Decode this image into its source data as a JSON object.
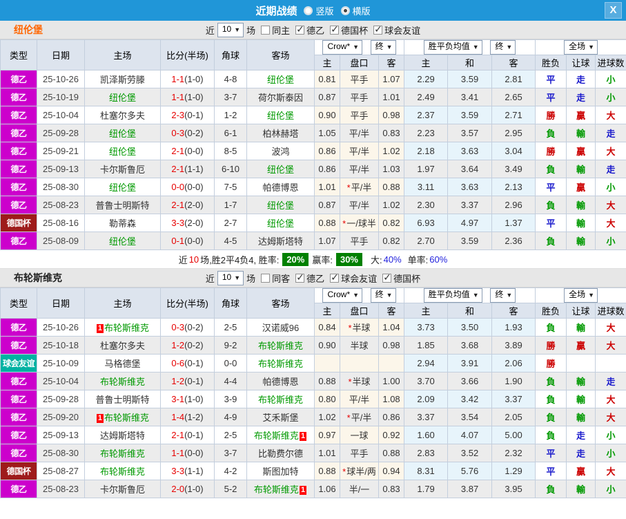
{
  "title_bar": {
    "title": "近期战绩",
    "radio_vertical": "竖版",
    "radio_horizontal": "横版",
    "close_label": "X"
  },
  "header": {
    "col_type": "类型",
    "col_date": "日期",
    "col_home": "主场",
    "col_score": "比分(半场)",
    "col_corner": "角球",
    "col_away": "客场",
    "select_bookmaker": "Crow*",
    "select_final1": "终",
    "select_avg": "胜平负均值",
    "select_final2": "终",
    "select_fullmatch": "全场",
    "sub": [
      "主",
      "盘口",
      "客",
      "主",
      "和",
      "客",
      "胜负",
      "让球",
      "进球数"
    ]
  },
  "sections": [
    {
      "team": "纽伦堡",
      "team_color": "#ff6600",
      "controls": {
        "near": "近",
        "count": "10",
        "games": "场",
        "same_label": "同主",
        "same_checked": false,
        "leagues": [
          {
            "label": "德乙",
            "checked": true
          },
          {
            "label": "德国杯",
            "checked": true
          },
          {
            "label": "球会友谊",
            "checked": true
          }
        ]
      },
      "rows": [
        {
          "lg": "德乙",
          "lt": "l2",
          "d": "25-10-26",
          "h": "凯泽斯劳滕",
          "hs": false,
          "hb": "",
          "s": "1-1",
          "hf": "(1-0)",
          "c": "4-8",
          "a": "纽伦堡",
          "as": true,
          "ab": "",
          "o1": "0.81",
          "o2": "平手",
          "st": false,
          "o3": "1.07",
          "e1": "2.29",
          "e2": "3.59",
          "e3": "2.81",
          "r1": "平",
          "r1c": "b",
          "r2": "走",
          "r2c": "b",
          "r3": "小",
          "r3c": "g"
        },
        {
          "lg": "德乙",
          "lt": "l2",
          "d": "25-10-19",
          "h": "纽伦堡",
          "hs": true,
          "hb": "",
          "s": "1-1",
          "hf": "(1-0)",
          "c": "3-7",
          "a": "荷尔斯泰因",
          "as": false,
          "ab": "",
          "o1": "0.87",
          "o2": "平手",
          "st": false,
          "o3": "1.01",
          "e1": "2.49",
          "e2": "3.41",
          "e3": "2.65",
          "r1": "平",
          "r1c": "b",
          "r2": "走",
          "r2c": "b",
          "r3": "小",
          "r3c": "g"
        },
        {
          "lg": "德乙",
          "lt": "l2",
          "d": "25-10-04",
          "h": "杜塞尔多夫",
          "hs": false,
          "hb": "",
          "s": "2-3",
          "hf": "(0-1)",
          "c": "1-2",
          "a": "纽伦堡",
          "as": true,
          "ab": "",
          "o1": "0.90",
          "o2": "平手",
          "st": false,
          "o3": "0.98",
          "e1": "2.37",
          "e2": "3.59",
          "e3": "2.71",
          "r1": "勝",
          "r1c": "r",
          "r2": "贏",
          "r2c": "r",
          "r3": "大",
          "r3c": "r"
        },
        {
          "lg": "德乙",
          "lt": "l2",
          "d": "25-09-28",
          "h": "纽伦堡",
          "hs": true,
          "hb": "",
          "s": "0-3",
          "hf": "(0-2)",
          "c": "6-1",
          "a": "柏林赫塔",
          "as": false,
          "ab": "",
          "o1": "1.05",
          "o2": "平/半",
          "st": false,
          "o3": "0.83",
          "e1": "2.23",
          "e2": "3.57",
          "e3": "2.95",
          "r1": "負",
          "r1c": "g",
          "r2": "輸",
          "r2c": "g",
          "r3": "走",
          "r3c": "b"
        },
        {
          "lg": "德乙",
          "lt": "l2",
          "d": "25-09-21",
          "h": "纽伦堡",
          "hs": true,
          "hb": "",
          "s": "2-1",
          "hf": "(0-0)",
          "c": "8-5",
          "a": "波鸿",
          "as": false,
          "ab": "",
          "o1": "0.86",
          "o2": "平/半",
          "st": false,
          "o3": "1.02",
          "e1": "2.18",
          "e2": "3.63",
          "e3": "3.04",
          "r1": "勝",
          "r1c": "r",
          "r2": "贏",
          "r2c": "r",
          "r3": "大",
          "r3c": "r"
        },
        {
          "lg": "德乙",
          "lt": "l2",
          "d": "25-09-13",
          "h": "卡尔斯鲁厄",
          "hs": false,
          "hb": "",
          "s": "2-1",
          "hf": "(1-1)",
          "c": "6-10",
          "a": "纽伦堡",
          "as": true,
          "ab": "",
          "o1": "0.86",
          "o2": "平/半",
          "st": false,
          "o3": "1.03",
          "e1": "1.97",
          "e2": "3.64",
          "e3": "3.49",
          "r1": "負",
          "r1c": "g",
          "r2": "輸",
          "r2c": "g",
          "r3": "走",
          "r3c": "b"
        },
        {
          "lg": "德乙",
          "lt": "l2",
          "d": "25-08-30",
          "h": "纽伦堡",
          "hs": true,
          "hb": "",
          "s": "0-0",
          "hf": "(0-0)",
          "c": "7-5",
          "a": "帕德博恩",
          "as": false,
          "ab": "",
          "o1": "1.01",
          "o2": "平/半",
          "st": true,
          "o3": "0.88",
          "e1": "3.11",
          "e2": "3.63",
          "e3": "2.13",
          "r1": "平",
          "r1c": "b",
          "r2": "贏",
          "r2c": "r",
          "r3": "小",
          "r3c": "g"
        },
        {
          "lg": "德乙",
          "lt": "l2",
          "d": "25-08-23",
          "h": "普鲁士明斯特",
          "hs": false,
          "hb": "",
          "s": "2-1",
          "hf": "(2-0)",
          "c": "1-7",
          "a": "纽伦堡",
          "as": true,
          "ab": "",
          "o1": "0.87",
          "o2": "平/半",
          "st": false,
          "o3": "1.02",
          "e1": "2.30",
          "e2": "3.37",
          "e3": "2.96",
          "r1": "負",
          "r1c": "g",
          "r2": "輸",
          "r2c": "g",
          "r3": "大",
          "r3c": "r"
        },
        {
          "lg": "德国杯",
          "lt": "cup",
          "d": "25-08-16",
          "h": "勒蒂森",
          "hs": false,
          "hb": "",
          "s": "3-3",
          "hf": "(2-0)",
          "c": "2-7",
          "a": "纽伦堡",
          "as": true,
          "ab": "",
          "o1": "0.88",
          "o2": "一/球半",
          "st": true,
          "o3": "0.82",
          "e1": "6.93",
          "e2": "4.97",
          "e3": "1.37",
          "r1": "平",
          "r1c": "b",
          "r2": "輸",
          "r2c": "g",
          "r3": "大",
          "r3c": "r"
        },
        {
          "lg": "德乙",
          "lt": "l2",
          "d": "25-08-09",
          "h": "纽伦堡",
          "hs": true,
          "hb": "",
          "s": "0-1",
          "hf": "(0-0)",
          "c": "4-5",
          "a": "达姆斯塔特",
          "as": false,
          "ab": "",
          "o1": "1.07",
          "o2": "平手",
          "st": false,
          "o3": "0.82",
          "e1": "2.70",
          "e2": "3.59",
          "e3": "2.36",
          "r1": "負",
          "r1c": "g",
          "r2": "輸",
          "r2c": "g",
          "r3": "小",
          "r3c": "g"
        }
      ],
      "summary": {
        "p1": "近",
        "p2": "10",
        "p3": "场,胜2平4负4, 胜率:",
        "badge1": "20%",
        "p4": "赢率:",
        "badge2": "30%",
        "p5": "大:",
        "v1": "40%",
        "p6": "单率:",
        "v2": "60%"
      }
    },
    {
      "team": "布轮斯维克",
      "team_color": "#222222",
      "controls": {
        "near": "近",
        "count": "10",
        "games": "场",
        "same_label": "同客",
        "same_checked": false,
        "leagues": [
          {
            "label": "德乙",
            "checked": true
          },
          {
            "label": "球会友谊",
            "checked": true
          },
          {
            "label": "德国杯",
            "checked": true
          }
        ]
      },
      "rows": [
        {
          "lg": "德乙",
          "lt": "l2",
          "d": "25-10-26",
          "h": "布轮斯维克",
          "hs": true,
          "hb": "1",
          "s": "0-3",
          "hf": "(0-2)",
          "c": "2-5",
          "a": "汉诺威96",
          "as": false,
          "ab": "",
          "o1": "0.84",
          "o2": "半球",
          "st": true,
          "o3": "1.04",
          "e1": "3.73",
          "e2": "3.50",
          "e3": "1.93",
          "r1": "負",
          "r1c": "g",
          "r2": "輸",
          "r2c": "g",
          "r3": "大",
          "r3c": "r"
        },
        {
          "lg": "德乙",
          "lt": "l2",
          "d": "25-10-18",
          "h": "杜塞尔多夫",
          "hs": false,
          "hb": "",
          "s": "1-2",
          "hf": "(0-2)",
          "c": "9-2",
          "a": "布轮斯维克",
          "as": true,
          "ab": "",
          "o1": "0.90",
          "o2": "半球",
          "st": false,
          "o3": "0.98",
          "e1": "1.85",
          "e2": "3.68",
          "e3": "3.89",
          "r1": "勝",
          "r1c": "r",
          "r2": "贏",
          "r2c": "r",
          "r3": "大",
          "r3c": "r"
        },
        {
          "lg": "球会友谊",
          "lt": "fr",
          "d": "25-10-09",
          "h": "马格德堡",
          "hs": false,
          "hb": "",
          "s": "0-6",
          "hf": "(0-1)",
          "c": "0-0",
          "a": "布轮斯维克",
          "as": true,
          "ab": "",
          "o1": "",
          "o2": "",
          "st": false,
          "o3": "",
          "e1": "2.94",
          "e2": "3.91",
          "e3": "2.06",
          "r1": "勝",
          "r1c": "r",
          "r2": "",
          "r2c": "b",
          "r3": "",
          "r3c": "b"
        },
        {
          "lg": "德乙",
          "lt": "l2",
          "d": "25-10-04",
          "h": "布轮斯维克",
          "hs": true,
          "hb": "",
          "s": "1-2",
          "hf": "(0-1)",
          "c": "4-4",
          "a": "帕德博恩",
          "as": false,
          "ab": "",
          "o1": "0.88",
          "o2": "半球",
          "st": true,
          "o3": "1.00",
          "e1": "3.70",
          "e2": "3.66",
          "e3": "1.90",
          "r1": "負",
          "r1c": "g",
          "r2": "輸",
          "r2c": "g",
          "r3": "走",
          "r3c": "b"
        },
        {
          "lg": "德乙",
          "lt": "l2",
          "d": "25-09-28",
          "h": "普鲁士明斯特",
          "hs": false,
          "hb": "",
          "s": "3-1",
          "hf": "(1-0)",
          "c": "3-9",
          "a": "布轮斯维克",
          "as": true,
          "ab": "",
          "o1": "0.80",
          "o2": "平/半",
          "st": false,
          "o3": "1.08",
          "e1": "2.09",
          "e2": "3.42",
          "e3": "3.37",
          "r1": "負",
          "r1c": "g",
          "r2": "輸",
          "r2c": "g",
          "r3": "大",
          "r3c": "r"
        },
        {
          "lg": "德乙",
          "lt": "l2",
          "d": "25-09-20",
          "h": "布轮斯维克",
          "hs": true,
          "hb": "1",
          "s": "1-4",
          "hf": "(1-2)",
          "c": "4-9",
          "a": "艾禾斯堡",
          "as": false,
          "ab": "",
          "o1": "1.02",
          "o2": "平/半",
          "st": true,
          "o3": "0.86",
          "e1": "3.37",
          "e2": "3.54",
          "e3": "2.05",
          "r1": "負",
          "r1c": "g",
          "r2": "輸",
          "r2c": "g",
          "r3": "大",
          "r3c": "r"
        },
        {
          "lg": "德乙",
          "lt": "l2",
          "d": "25-09-13",
          "h": "达姆斯塔特",
          "hs": false,
          "hb": "",
          "s": "2-1",
          "hf": "(0-1)",
          "c": "2-5",
          "a": "布轮斯维克",
          "as": true,
          "ab": "1",
          "o1": "0.97",
          "o2": "一球",
          "st": false,
          "o3": "0.92",
          "e1": "1.60",
          "e2": "4.07",
          "e3": "5.00",
          "r1": "負",
          "r1c": "g",
          "r2": "走",
          "r2c": "b",
          "r3": "小",
          "r3c": "g"
        },
        {
          "lg": "德乙",
          "lt": "l2",
          "d": "25-08-30",
          "h": "布轮斯维克",
          "hs": true,
          "hb": "",
          "s": "1-1",
          "hf": "(0-0)",
          "c": "3-7",
          "a": "比勒费尔德",
          "as": false,
          "ab": "",
          "o1": "1.01",
          "o2": "平手",
          "st": false,
          "o3": "0.88",
          "e1": "2.83",
          "e2": "3.52",
          "e3": "2.32",
          "r1": "平",
          "r1c": "b",
          "r2": "走",
          "r2c": "b",
          "r3": "小",
          "r3c": "g"
        },
        {
          "lg": "德国杯",
          "lt": "cup",
          "d": "25-08-27",
          "h": "布轮斯维克",
          "hs": true,
          "hb": "",
          "s": "3-3",
          "hf": "(1-1)",
          "c": "4-2",
          "a": "斯图加特",
          "as": false,
          "ab": "",
          "o1": "0.88",
          "o2": "球半/两",
          "st": true,
          "o3": "0.94",
          "e1": "8.31",
          "e2": "5.76",
          "e3": "1.29",
          "r1": "平",
          "r1c": "b",
          "r2": "贏",
          "r2c": "r",
          "r3": "大",
          "r3c": "r"
        },
        {
          "lg": "德乙",
          "lt": "l2",
          "d": "25-08-23",
          "h": "卡尔斯鲁厄",
          "hs": false,
          "hb": "",
          "s": "2-0",
          "hf": "(1-0)",
          "c": "5-2",
          "a": "布轮斯维克",
          "as": true,
          "ab": "1",
          "o1": "1.06",
          "o2": "半/一",
          "st": false,
          "o3": "0.83",
          "e1": "1.79",
          "e2": "3.87",
          "e3": "3.95",
          "r1": "負",
          "r1c": "g",
          "r2": "輸",
          "r2c": "g",
          "r3": "小",
          "r3c": "g"
        }
      ]
    }
  ]
}
